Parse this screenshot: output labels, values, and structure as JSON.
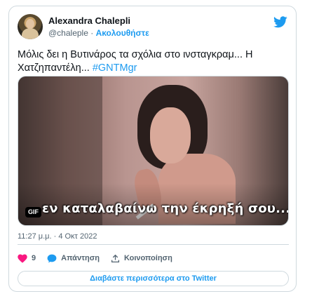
{
  "author": {
    "name": "Alexandra Chalepli",
    "handle": "@chaleple",
    "separator": " · ",
    "follow_label": "Ακολουθήστε"
  },
  "tweet": {
    "text": "Μόλις δει η Βυτινάρος τα σχόλια στο ινσταγκραμ... Η Χατζηπαντέλη... ",
    "hashtag": "#GNTMgr",
    "timestamp": "11:27 μ.μ. · 4 Οκτ 2022"
  },
  "media": {
    "badge": "GIF",
    "caption": "εν καταλαβαίνω την έκρηξή σου..."
  },
  "actions": {
    "like_count": "9",
    "reply_label": "Απάντηση",
    "share_label": "Κοινοποίηση"
  },
  "read_more": "Διαβάστε περισσότερα στο Twitter",
  "colors": {
    "accent": "#1d9bf0",
    "like": "#f91880",
    "text": "#0f1419",
    "muted": "#536471",
    "border": "#cfd9de"
  },
  "icons": {
    "logo": "twitter-bird-icon",
    "like": "heart-icon",
    "reply": "speech-bubble-icon",
    "share": "share-arrow-icon"
  }
}
